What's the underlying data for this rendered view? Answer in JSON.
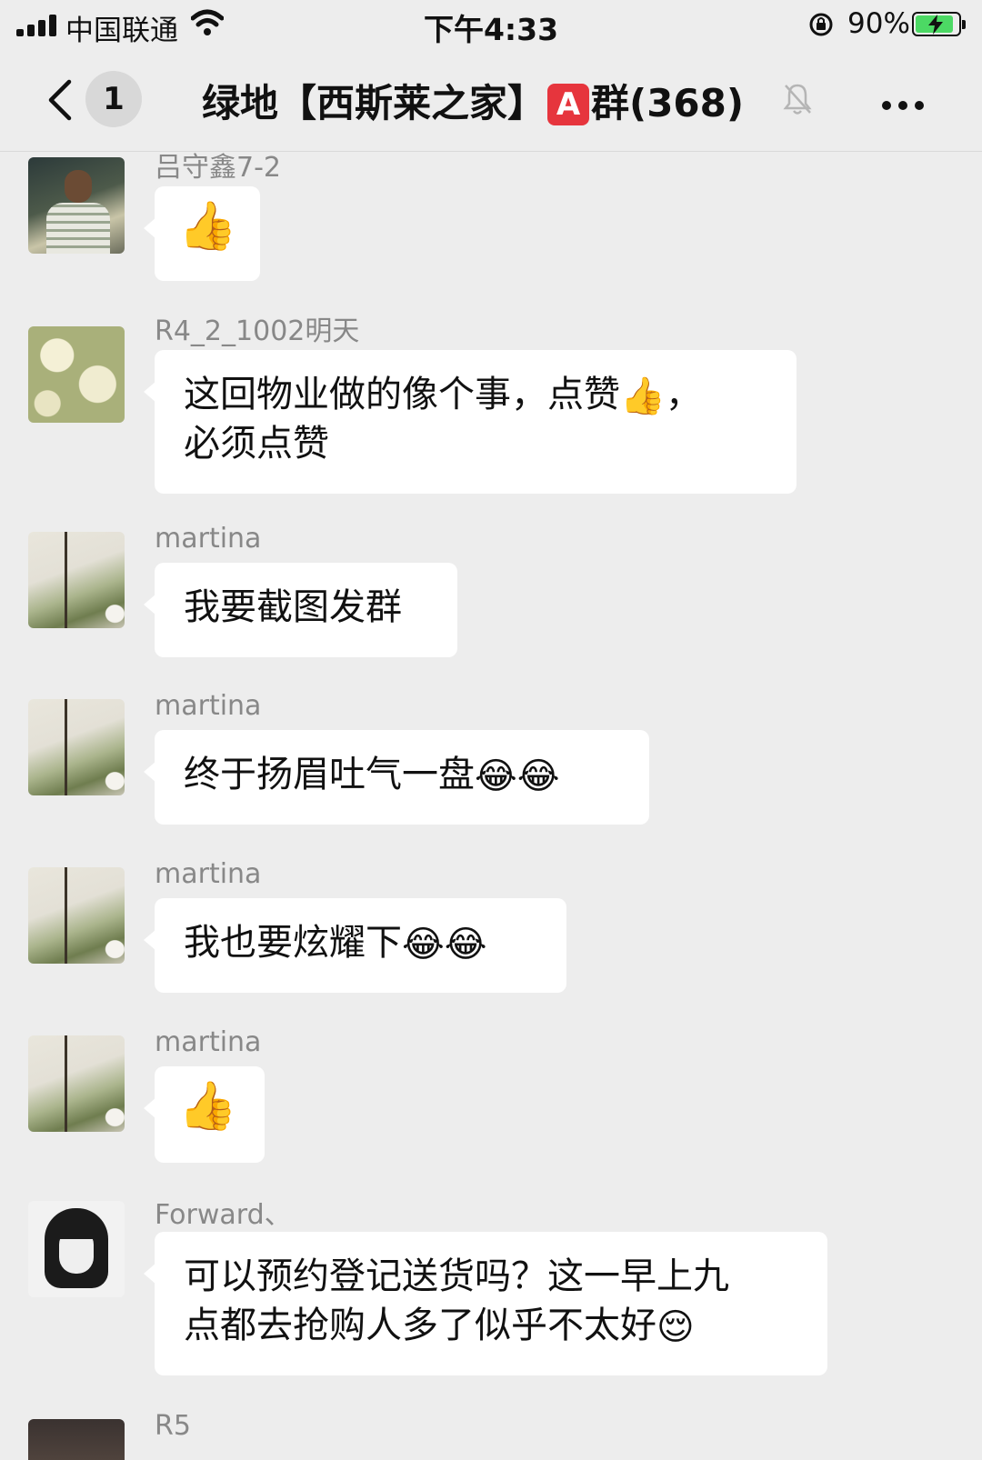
{
  "status_bar": {
    "carrier": "中国联通",
    "time": "下午4:33",
    "battery_percent": "90%",
    "battery_level": 0.9,
    "icons": [
      "signal-icon",
      "wifi-icon",
      "rotation-lock-icon",
      "battery-charging-icon"
    ]
  },
  "nav": {
    "back_icon": "chevron-left-icon",
    "unread_count": "1",
    "title_prefix": "绿地【西斯莱之家】",
    "title_badge": "A",
    "title_suffix": "群(368)",
    "mute_icon": "bell-off-icon",
    "more_icon": "more-icon"
  },
  "messages": [
    {
      "sender": "吕守鑫7-2",
      "text": "",
      "emoji": [
        "👍"
      ]
    },
    {
      "sender": "R4_2_1002明天",
      "text_line1": "这回物业做的像个事，点赞",
      "emoji": [
        "👍"
      ],
      "text_line1_end": "，",
      "text_line2": "必须点赞"
    },
    {
      "sender": "martina",
      "text": "我要截图发群"
    },
    {
      "sender": "martina",
      "text": "终于扬眉吐气一盘",
      "emoji": [
        "😂",
        "😂"
      ]
    },
    {
      "sender": "martina",
      "text": "我也要炫耀下",
      "emoji": [
        "😂",
        "😂"
      ]
    },
    {
      "sender": "martina",
      "text": "",
      "emoji": [
        "👍"
      ]
    },
    {
      "sender": "Forward、",
      "text_line1": "可以预约登记送货吗？这一早上九",
      "text_line2": "点都去抢购人多了似乎不太好",
      "emoji": [
        "😌"
      ]
    },
    {
      "sender": "R5"
    }
  ],
  "colors": {
    "background": "#ededed",
    "bubble": "#ffffff",
    "sender_name": "#888888",
    "badge_red": "#e6353d",
    "battery_green": "#4cd964"
  }
}
